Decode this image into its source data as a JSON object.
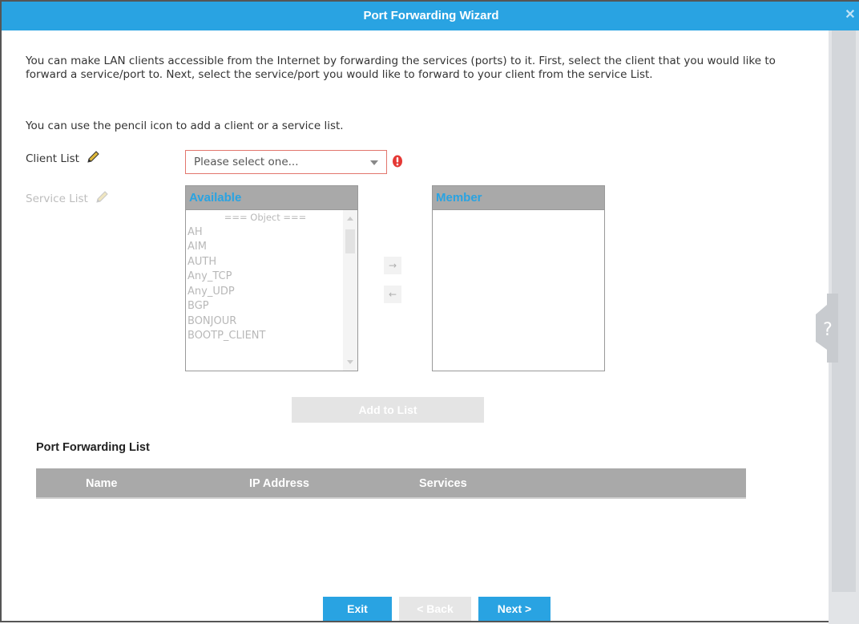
{
  "window": {
    "title": "Port Forwarding Wizard",
    "close_glyph": "✕"
  },
  "intro": {
    "paragraph": "You can make LAN clients accessible from the Internet by forwarding the services (ports) to it. First, select the client that you would like to forward a service/port to. Next, select the service/port you would like to forward to your client from the service List.",
    "pencil_hint": "You can use the pencil icon to add a client or a service list."
  },
  "client_list": {
    "label": "Client List",
    "icon": "pencil-icon",
    "select_value": "Please select one...",
    "error_icon": "exclamation-icon",
    "error_color": "#e53935"
  },
  "service_list": {
    "label": "Service List",
    "icon": "pencil-icon",
    "available": {
      "header": "Available",
      "items": [
        "=== Object ===",
        "AH",
        "AIM",
        "AUTH",
        "Any_TCP",
        "Any_UDP",
        "BGP",
        "BONJOUR",
        "BOOTP_CLIENT"
      ]
    },
    "member": {
      "header": "Member"
    },
    "move_right_icon": "arrow-right-icon",
    "move_left_icon": "arrow-left-icon",
    "move_right_glyph": "→",
    "move_left_glyph": "←"
  },
  "add_to_list_button": "Add to List",
  "port_forwarding_list": {
    "title": "Port Forwarding List",
    "columns": [
      "Name",
      "IP Address",
      "Services"
    ],
    "rows": []
  },
  "help": {
    "icon": "question-icon"
  },
  "footer": {
    "exit": "Exit",
    "back": "< Back",
    "next": "Next >"
  },
  "colors": {
    "accent": "#29a3e2",
    "header_gray": "#a9a9a9",
    "error_border": "#e2766d"
  }
}
